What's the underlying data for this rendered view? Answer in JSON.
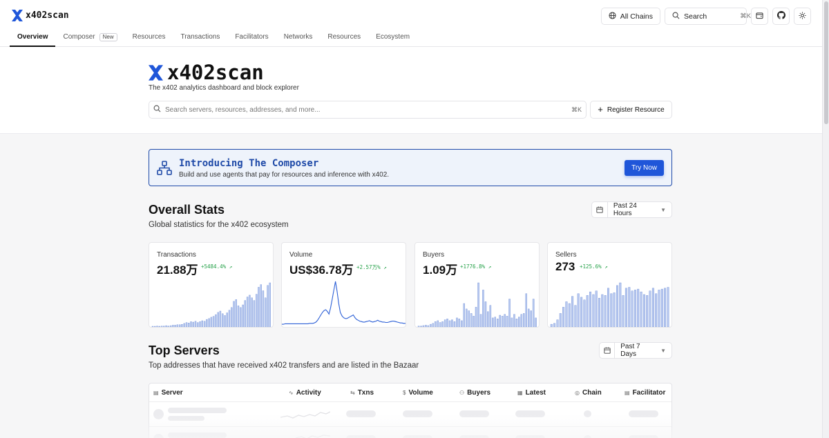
{
  "brand": {
    "name": "x402scan"
  },
  "colors": {
    "accent": "#1f56d9",
    "banner_border": "#1f4aa8",
    "positive": "#22a046",
    "chart_bar": "#b9c9f0"
  },
  "nav": {
    "tabs": [
      {
        "label": "Overview",
        "active": true
      },
      {
        "label": "Composer",
        "badge": "New"
      },
      {
        "label": "Resources"
      },
      {
        "label": "Transactions"
      },
      {
        "label": "Facilitators"
      },
      {
        "label": "Networks"
      },
      {
        "label": "Resources"
      },
      {
        "label": "Ecosystem"
      }
    ]
  },
  "topbar": {
    "chains_label": "All Chains",
    "search_label": "Search",
    "search_shortcut": "⌘K"
  },
  "hero": {
    "title": "x402scan",
    "subtitle": "The x402 analytics dashboard and block explorer",
    "search_placeholder": "Search servers, resources, addresses, and more...",
    "search_shortcut": "⌘K",
    "register_label": "Register Resource"
  },
  "banner": {
    "title": "Introducing The Composer",
    "description": "Build and use agents that pay for resources and inference with x402.",
    "cta": "Try Now"
  },
  "overall": {
    "title": "Overall Stats",
    "subtitle": "Global statistics for the x402 ecosystem",
    "range": "Past 24 Hours",
    "cards": [
      {
        "label": "Transactions",
        "value": "21.88万",
        "delta": "+5484.4%",
        "chart": "bar",
        "series": [
          1,
          1,
          2,
          1,
          2,
          2,
          3,
          2,
          3,
          4,
          4,
          5,
          5,
          6,
          8,
          10,
          9,
          12,
          11,
          13,
          10,
          12,
          14,
          13,
          17,
          19,
          22,
          24,
          28,
          33,
          36,
          30,
          26,
          32,
          38,
          44,
          58,
          62,
          48,
          44,
          50,
          60,
          68,
          72,
          66,
          60,
          74,
          90,
          96,
          82,
          66,
          94,
          100
        ]
      },
      {
        "label": "Volume",
        "value": "US$36.78万",
        "delta": "+2.57万%",
        "chart": "line",
        "series": [
          3,
          3,
          4,
          4,
          4,
          4,
          4,
          4,
          4,
          4,
          4,
          4,
          4,
          4,
          4,
          4,
          4,
          5,
          5,
          5,
          6,
          8,
          12,
          18,
          24,
          30,
          34,
          36,
          32,
          26,
          40,
          60,
          80,
          100,
          78,
          50,
          30,
          22,
          18,
          16,
          16,
          18,
          20,
          22,
          24,
          18,
          14,
          12,
          10,
          9,
          8,
          8,
          9,
          10,
          11,
          9,
          8,
          9,
          10,
          12,
          10,
          9,
          8,
          8,
          7,
          7,
          8,
          9,
          10,
          10,
          9,
          8,
          7,
          6,
          6,
          5,
          5,
          5
        ]
      },
      {
        "label": "Buyers",
        "value": "1.09万",
        "delta": "+1776.8%",
        "chart": "bar",
        "series": [
          2,
          2,
          3,
          4,
          3,
          6,
          8,
          12,
          14,
          10,
          12,
          16,
          18,
          14,
          16,
          12,
          20,
          18,
          14,
          52,
          40,
          36,
          30,
          24,
          44,
          98,
          28,
          82,
          56,
          34,
          48,
          20,
          22,
          18,
          26,
          24,
          28,
          24,
          62,
          20,
          28,
          18,
          22,
          28,
          30,
          74,
          40,
          36,
          62,
          20
        ]
      },
      {
        "label": "Sellers",
        "value": "273",
        "delta": "+125.6%",
        "chart": "bar",
        "series": [
          6,
          8,
          16,
          30,
          44,
          56,
          52,
          68,
          48,
          74,
          66,
          60,
          70,
          78,
          72,
          80,
          64,
          72,
          70,
          86,
          74,
          76,
          92,
          98,
          70,
          86,
          88,
          80,
          82,
          84,
          78,
          72,
          70,
          80,
          86,
          74,
          82,
          84,
          86,
          88
        ]
      }
    ]
  },
  "top_servers": {
    "title": "Top Servers",
    "subtitle": "Top addresses that have received x402 transfers and are listed in the Bazaar",
    "range": "Past 7 Days",
    "columns": [
      "Server",
      "Activity",
      "Txns",
      "Volume",
      "Buyers",
      "Latest",
      "Chain",
      "Facilitator"
    ]
  }
}
